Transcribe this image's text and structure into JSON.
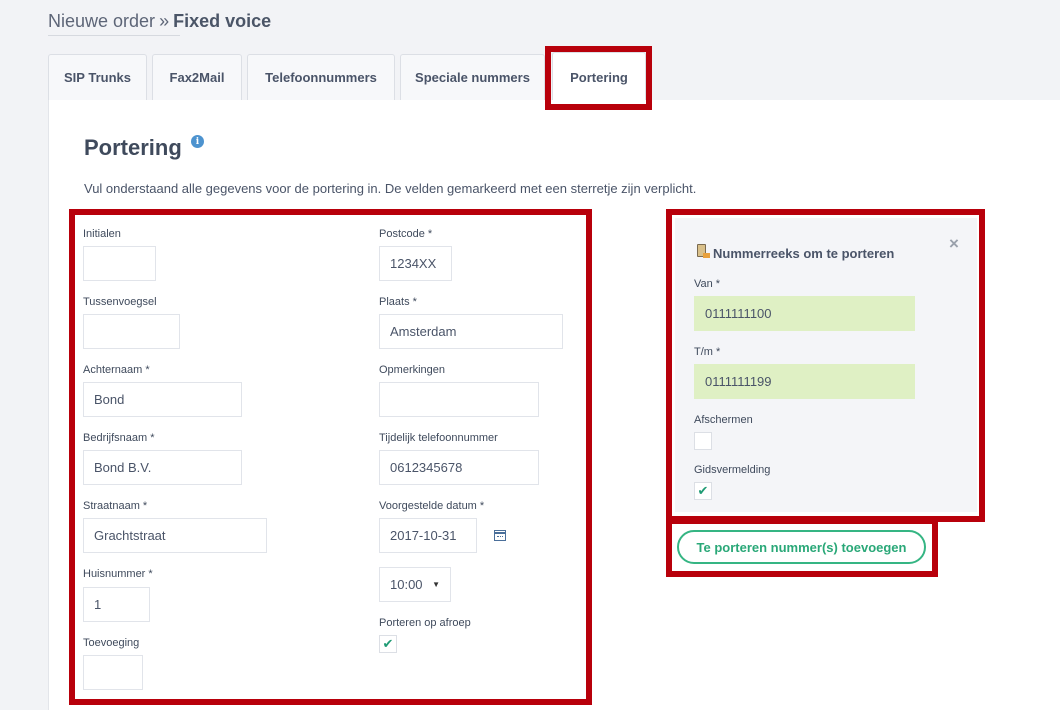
{
  "breadcrumb": {
    "parent": "Nieuwe order",
    "separator": "»",
    "current": "Fixed voice"
  },
  "tabs": [
    {
      "label": "SIP Trunks"
    },
    {
      "label": "Fax2Mail"
    },
    {
      "label": "Telefoonnummers"
    },
    {
      "label": "Speciale nummers"
    },
    {
      "label": "Portering",
      "active": true
    }
  ],
  "page": {
    "title": "Portering",
    "info_icon": "i",
    "description": "Vul onderstaand alle gegevens voor de portering in. De velden gemarkeerd met een sterretje zijn verplicht."
  },
  "form": {
    "initialen": {
      "label": "Initialen",
      "value": ""
    },
    "tussenvoegsel": {
      "label": "Tussenvoegsel",
      "value": ""
    },
    "achternaam": {
      "label": "Achternaam *",
      "value": "Bond"
    },
    "bedrijfsnaam": {
      "label": "Bedrijfsnaam *",
      "value": "Bond B.V."
    },
    "straatnaam": {
      "label": "Straatnaam *",
      "value": "Grachtstraat"
    },
    "huisnummer": {
      "label": "Huisnummer *",
      "value": "1"
    },
    "toevoeging": {
      "label": "Toevoeging",
      "value": ""
    },
    "postcode": {
      "label": "Postcode *",
      "value": "1234XX"
    },
    "plaats": {
      "label": "Plaats *",
      "value": "Amsterdam"
    },
    "opmerkingen": {
      "label": "Opmerkingen",
      "value": ""
    },
    "tijdelijk": {
      "label": "Tijdelijk telefoonnummer",
      "value": "0612345678"
    },
    "datum": {
      "label": "Voorgestelde datum *",
      "value": "2017-10-31"
    },
    "tijd": {
      "value": "10:00",
      "caret": "▼"
    },
    "afroep": {
      "label": "Porteren op afroep",
      "checked": true,
      "check": "✔"
    }
  },
  "range_panel": {
    "title": "Nummerreeks om te porteren",
    "close": "×",
    "van": {
      "label": "Van *",
      "value": "0111111100"
    },
    "tm": {
      "label": "T/m *",
      "value": "0111111199"
    },
    "afschermen": {
      "label": "Afschermen",
      "checked": false
    },
    "gidsvermelding": {
      "label": "Gidsvermelding",
      "checked": true,
      "check": "✔"
    },
    "add_button": "Te porteren nummer(s) toevoegen"
  },
  "colors": {
    "highlight": "#b8000b",
    "accent_green": "#35b583",
    "field_green": "#dff0c4"
  }
}
